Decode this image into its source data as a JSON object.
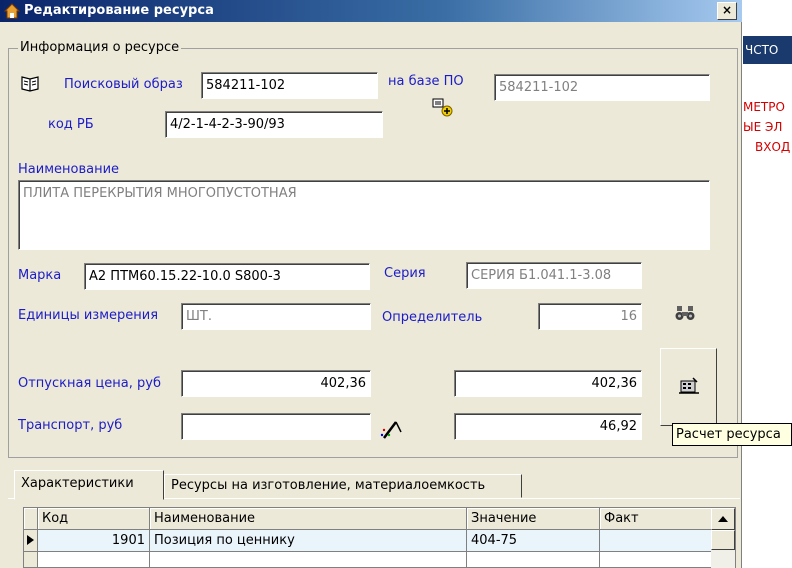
{
  "window": {
    "title": "Редактирование ресурса",
    "close_glyph": "×"
  },
  "group_title": "Информация о ресурсе",
  "fields": {
    "search_label": "Поисковый образ",
    "search_value": "584211-102",
    "base_label": "на базе ПО",
    "base_value": "584211-102",
    "rb_label": "код РБ",
    "rb_value": "4/2-1-4-2-3-90/93",
    "name_label": "Наименование",
    "name_value": "ПЛИТА ПЕРЕКРЫТИЯ МНОГОПУСТОТНАЯ",
    "mark_label": "Марка",
    "mark_value": "А2 ПТМ60.15.22-10.0 S800-3",
    "series_label": "Серия",
    "series_value": "СЕРИЯ Б1.041.1-3.08",
    "unit_label": "Единицы измерения",
    "unit_value": "ШТ.",
    "determ_label": "Определитель",
    "determ_value": "16",
    "price_label": "Отпускная цена, руб",
    "price_value": "402,36",
    "price_calc_value": "402,36",
    "transport_label": "Транспорт, руб",
    "transport_value": "",
    "transport_calc_value": "46,92"
  },
  "tooltip": "Расчет ресурса",
  "tabs": [
    {
      "label": "Характеристики"
    },
    {
      "label": "Ресурсы на изготовление, материалоемкость"
    }
  ],
  "table": {
    "columns": [
      "Код",
      "Наименование",
      "Значение",
      "Факт"
    ],
    "rows": [
      {
        "code": "1901",
        "name": "Позиция по ценнику",
        "value": "404-75",
        "fact": ""
      }
    ]
  },
  "background": {
    "strip_text": "ЧСТО",
    "red_lines": [
      "МЕТРО",
      "ЫЕ ЭЛ",
      "ВХОД"
    ]
  },
  "colors": {
    "titlebar": "#0a246a",
    "label_blue": "#1c1cc8",
    "dialog_bg": "#ece9d8"
  }
}
